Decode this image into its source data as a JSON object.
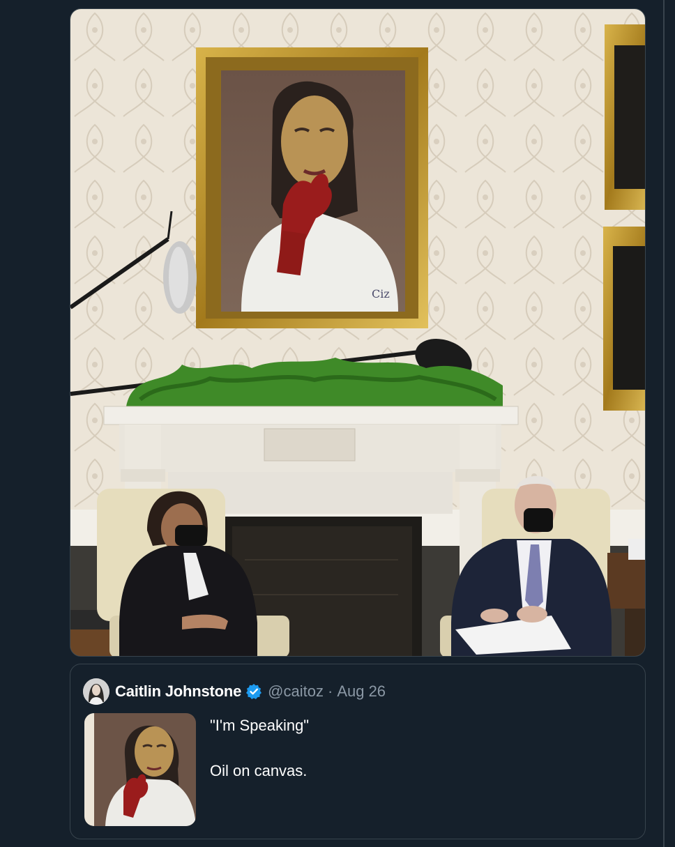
{
  "media": {
    "icon": "photo-oil-painting-hanging-in-office"
  },
  "quoted_tweet": {
    "author_name": "Caitlin Johnstone",
    "verified_icon": "verified-badge-icon",
    "handle": "@caitoz",
    "separator": "·",
    "date": "Aug 26",
    "lines": [
      "\"I'm Speaking\"",
      "Oil on canvas."
    ]
  },
  "colors": {
    "background": "#15202b",
    "border": "#38444d",
    "text_primary": "#ffffff",
    "text_secondary": "#8b98a5",
    "verified": "#1d9bf0"
  }
}
